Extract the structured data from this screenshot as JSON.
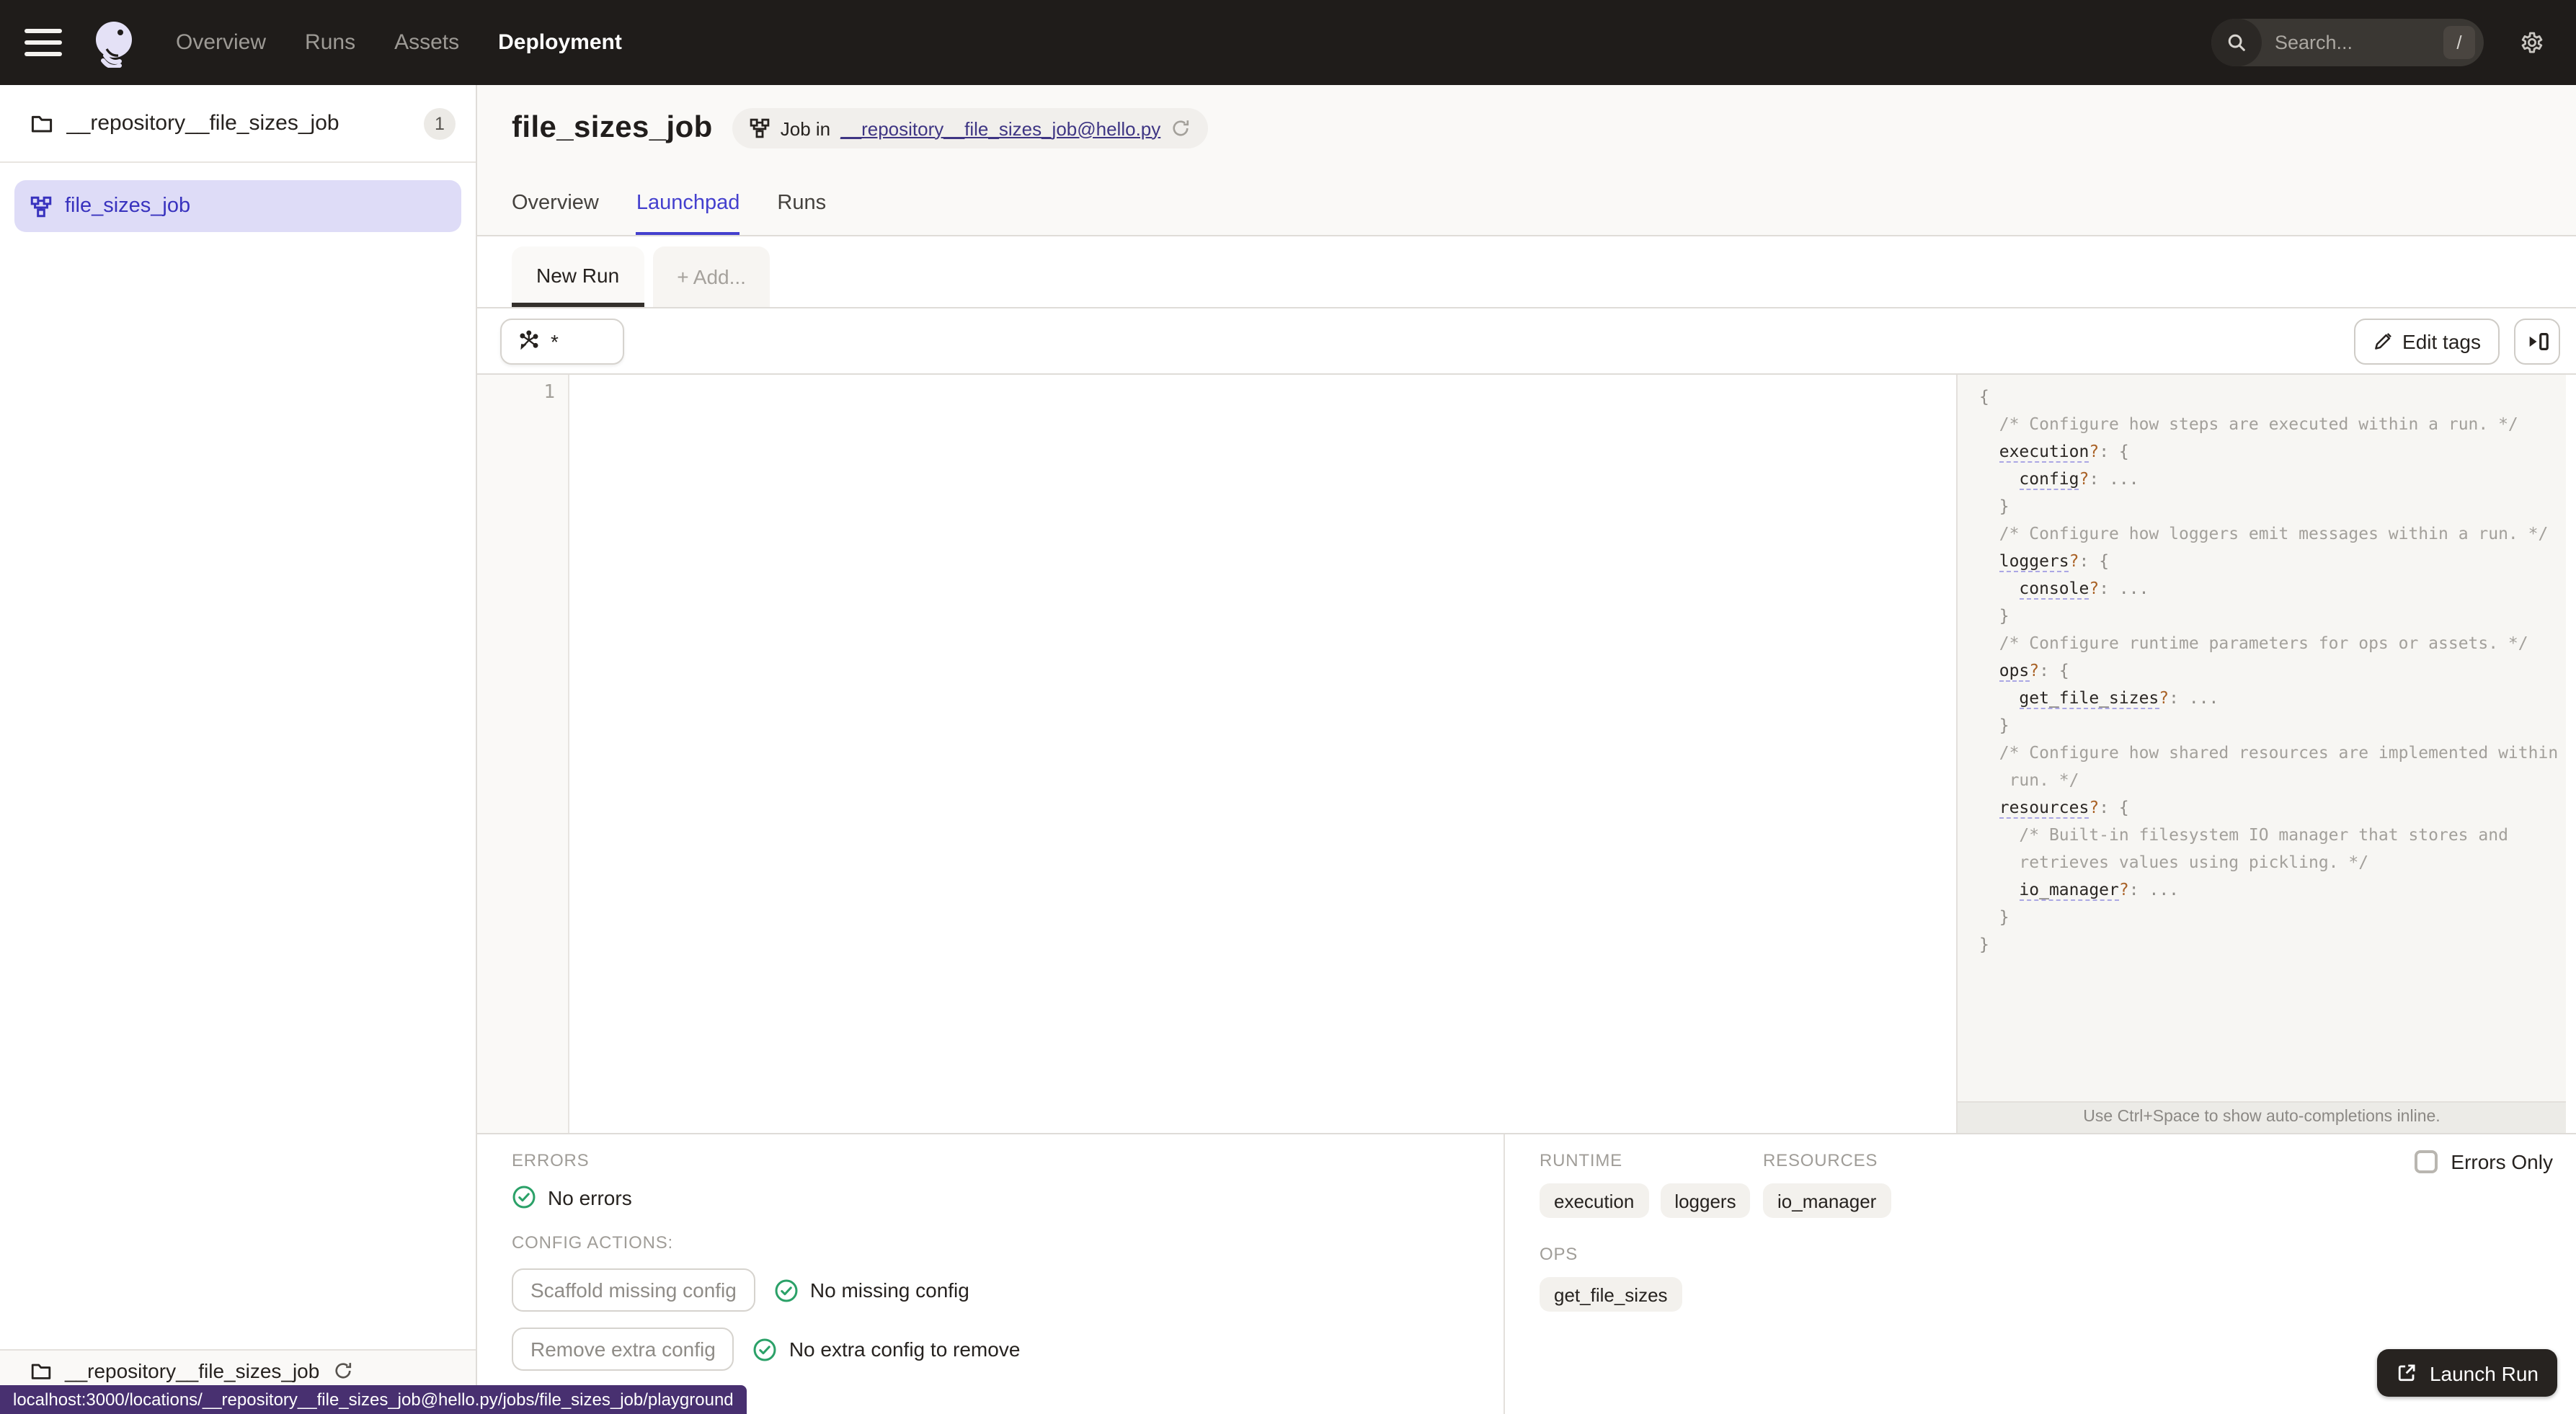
{
  "colors": {
    "nav_bg": "#1F1C1A",
    "accent_indigo": "#4440CE",
    "selected_item_bg": "#DEDCF7",
    "link_purple": "#3E3583",
    "success_green": "#2BA168",
    "tooltip_purple": "#483070",
    "launch_btn_bg": "#272320"
  },
  "nav": {
    "items": [
      "Overview",
      "Runs",
      "Assets",
      "Deployment"
    ],
    "active_item": "Deployment",
    "search": {
      "placeholder": "Search...",
      "shortcut": "/"
    }
  },
  "sidebar": {
    "repo_header": {
      "name": "__repository__file_sizes_job",
      "count": "1"
    },
    "items": [
      {
        "label": "file_sizes_job",
        "selected": true
      }
    ],
    "footer": {
      "repo_name": "__repository__file_sizes_job"
    }
  },
  "header": {
    "title": "file_sizes_job",
    "breadcrumb": {
      "prefix": "Job in",
      "link": "__repository__file_sizes_job@hello.py"
    },
    "tabs": [
      {
        "label": "Overview",
        "active": false
      },
      {
        "label": "Launchpad",
        "active": true
      },
      {
        "label": "Runs",
        "active": false
      }
    ]
  },
  "launchpad": {
    "config_tabs": {
      "active": "New Run",
      "add": "+ Add..."
    },
    "op_selector_value": "*",
    "edit_tags_label": "Edit tags",
    "editor": {
      "line_number": "1",
      "content": ""
    },
    "schema": {
      "lines": [
        [
          [
            "p",
            "{"
          ]
        ],
        [
          [
            "p",
            "  "
          ],
          [
            "c",
            "/* Configure how steps are executed within a run. */"
          ]
        ],
        [
          [
            "p",
            "  "
          ],
          [
            "k",
            "execution"
          ],
          [
            "q",
            "?"
          ],
          [
            "p",
            ": {"
          ]
        ],
        [
          [
            "p",
            "    "
          ],
          [
            "k",
            "config"
          ],
          [
            "q",
            "?"
          ],
          [
            "p",
            ": ..."
          ]
        ],
        [
          [
            "p",
            "  }"
          ]
        ],
        [
          [
            "p",
            "  "
          ],
          [
            "c",
            "/* Configure how loggers emit messages within a run. */"
          ]
        ],
        [
          [
            "p",
            "  "
          ],
          [
            "k",
            "loggers"
          ],
          [
            "q",
            "?"
          ],
          [
            "p",
            ": {"
          ]
        ],
        [
          [
            "p",
            "    "
          ],
          [
            "k",
            "console"
          ],
          [
            "q",
            "?"
          ],
          [
            "p",
            ": ..."
          ]
        ],
        [
          [
            "p",
            "  }"
          ]
        ],
        [
          [
            "p",
            "  "
          ],
          [
            "c",
            "/* Configure runtime parameters for ops or assets. */"
          ]
        ],
        [
          [
            "p",
            "  "
          ],
          [
            "k",
            "ops"
          ],
          [
            "q",
            "?"
          ],
          [
            "p",
            ": {"
          ]
        ],
        [
          [
            "p",
            "    "
          ],
          [
            "k",
            "get_file_sizes"
          ],
          [
            "q",
            "?"
          ],
          [
            "p",
            ": ..."
          ]
        ],
        [
          [
            "p",
            "  }"
          ]
        ],
        [
          [
            "p",
            "  "
          ],
          [
            "c",
            "/* Configure how shared resources are implemented within a"
          ]
        ],
        [
          [
            "p",
            "   "
          ],
          [
            "c",
            "run. */"
          ]
        ],
        [
          [
            "p",
            "  "
          ],
          [
            "k",
            "resources"
          ],
          [
            "q",
            "?"
          ],
          [
            "p",
            ": {"
          ]
        ],
        [
          [
            "p",
            "    "
          ],
          [
            "c",
            "/* Built-in filesystem IO manager that stores and"
          ]
        ],
        [
          [
            "p",
            "    "
          ],
          [
            "c",
            "retrieves values using pickling. */"
          ]
        ],
        [
          [
            "p",
            "    "
          ],
          [
            "k",
            "io_manager"
          ],
          [
            "q",
            "?"
          ],
          [
            "p",
            ": ..."
          ]
        ],
        [
          [
            "p",
            "  }"
          ]
        ],
        [
          [
            "p",
            "}"
          ]
        ]
      ]
    },
    "hint": "Use Ctrl+Space to show auto-completions inline."
  },
  "bottom": {
    "errors": {
      "label": "ERRORS",
      "status": "No errors"
    },
    "config_actions": {
      "label": "CONFIG ACTIONS:",
      "scaffold_button": "Scaffold missing config",
      "scaffold_status": "No missing config",
      "remove_button": "Remove extra config",
      "remove_status": "No extra config to remove"
    },
    "runtime": {
      "label": "RUNTIME",
      "tags": [
        "execution",
        "loggers"
      ]
    },
    "resources": {
      "label": "RESOURCES",
      "tags": [
        "io_manager"
      ]
    },
    "ops": {
      "label": "OPS",
      "tags": [
        "get_file_sizes"
      ]
    },
    "errors_only_label": "Errors Only",
    "launch_button": "Launch Run"
  },
  "statusbar": {
    "url": "localhost:3000/locations/__repository__file_sizes_job@hello.py/jobs/file_sizes_job/playground"
  }
}
